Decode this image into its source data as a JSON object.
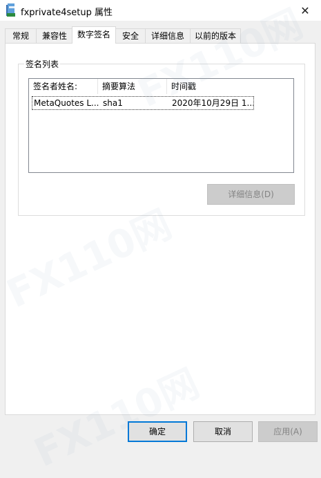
{
  "window": {
    "title": "fxprivate4setup 属性",
    "close_glyph": "✕"
  },
  "tabs": [
    {
      "label": "常规",
      "active": false
    },
    {
      "label": "兼容性",
      "active": false
    },
    {
      "label": "数字签名",
      "active": true
    },
    {
      "label": "安全",
      "active": false
    },
    {
      "label": "详细信息",
      "active": false
    },
    {
      "label": "以前的版本",
      "active": false
    }
  ],
  "signature_group": {
    "title": "签名列表",
    "columns": [
      "签名者姓名:",
      "摘要算法",
      "时间戳"
    ],
    "rows": [
      {
        "signer": "MetaQuotes L...",
        "algorithm": "sha1",
        "timestamp": "2020年10月29日 1..."
      }
    ],
    "details_button": "详细信息(D)"
  },
  "footer": {
    "ok": "确定",
    "cancel": "取消",
    "apply": "应用(A)"
  },
  "watermark_text": "FX110网",
  "colors": {
    "focus_border": "#0078d7",
    "disabled_text": "#838383"
  }
}
